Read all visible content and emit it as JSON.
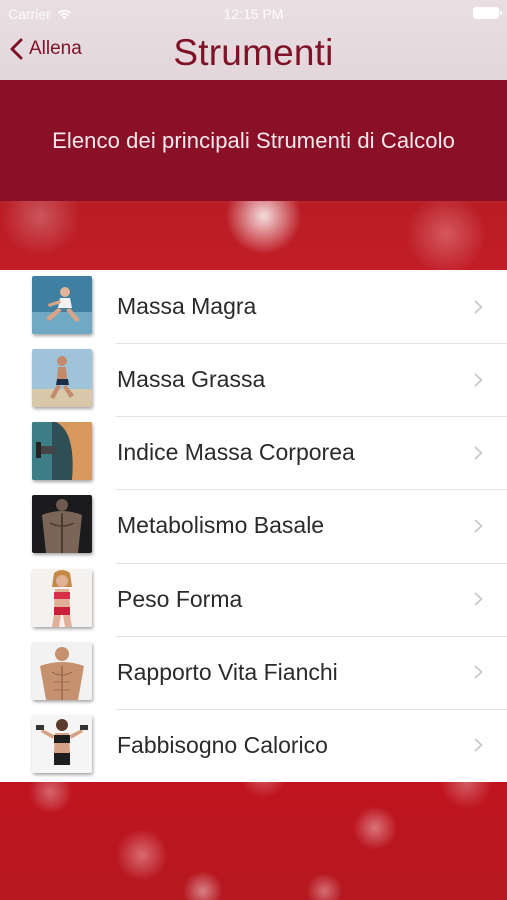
{
  "status_bar": {
    "carrier": "Carrier",
    "time": "12:15 PM"
  },
  "nav": {
    "back_label": "Allena",
    "title": "Strumenti"
  },
  "header": {
    "subtitle": "Elenco dei principali Strumenti di Calcolo"
  },
  "colors": {
    "accent": "#7e1226",
    "header_band": "#8a1028",
    "background": "#c0141f"
  },
  "tools": [
    {
      "label": "Massa Magra",
      "icon": "runner-woman-photo"
    },
    {
      "label": "Massa Grassa",
      "icon": "runner-man-photo"
    },
    {
      "label": "Indice Massa Corporea",
      "icon": "dumbbell-arm-photo"
    },
    {
      "label": "Metabolismo Basale",
      "icon": "muscular-back-photo"
    },
    {
      "label": "Peso Forma",
      "icon": "fit-woman-photo"
    },
    {
      "label": "Rapporto Vita Fianchi",
      "icon": "muscular-man-photo"
    },
    {
      "label": "Fabbisogno Calorico",
      "icon": "woman-dumbbells-photo"
    }
  ]
}
